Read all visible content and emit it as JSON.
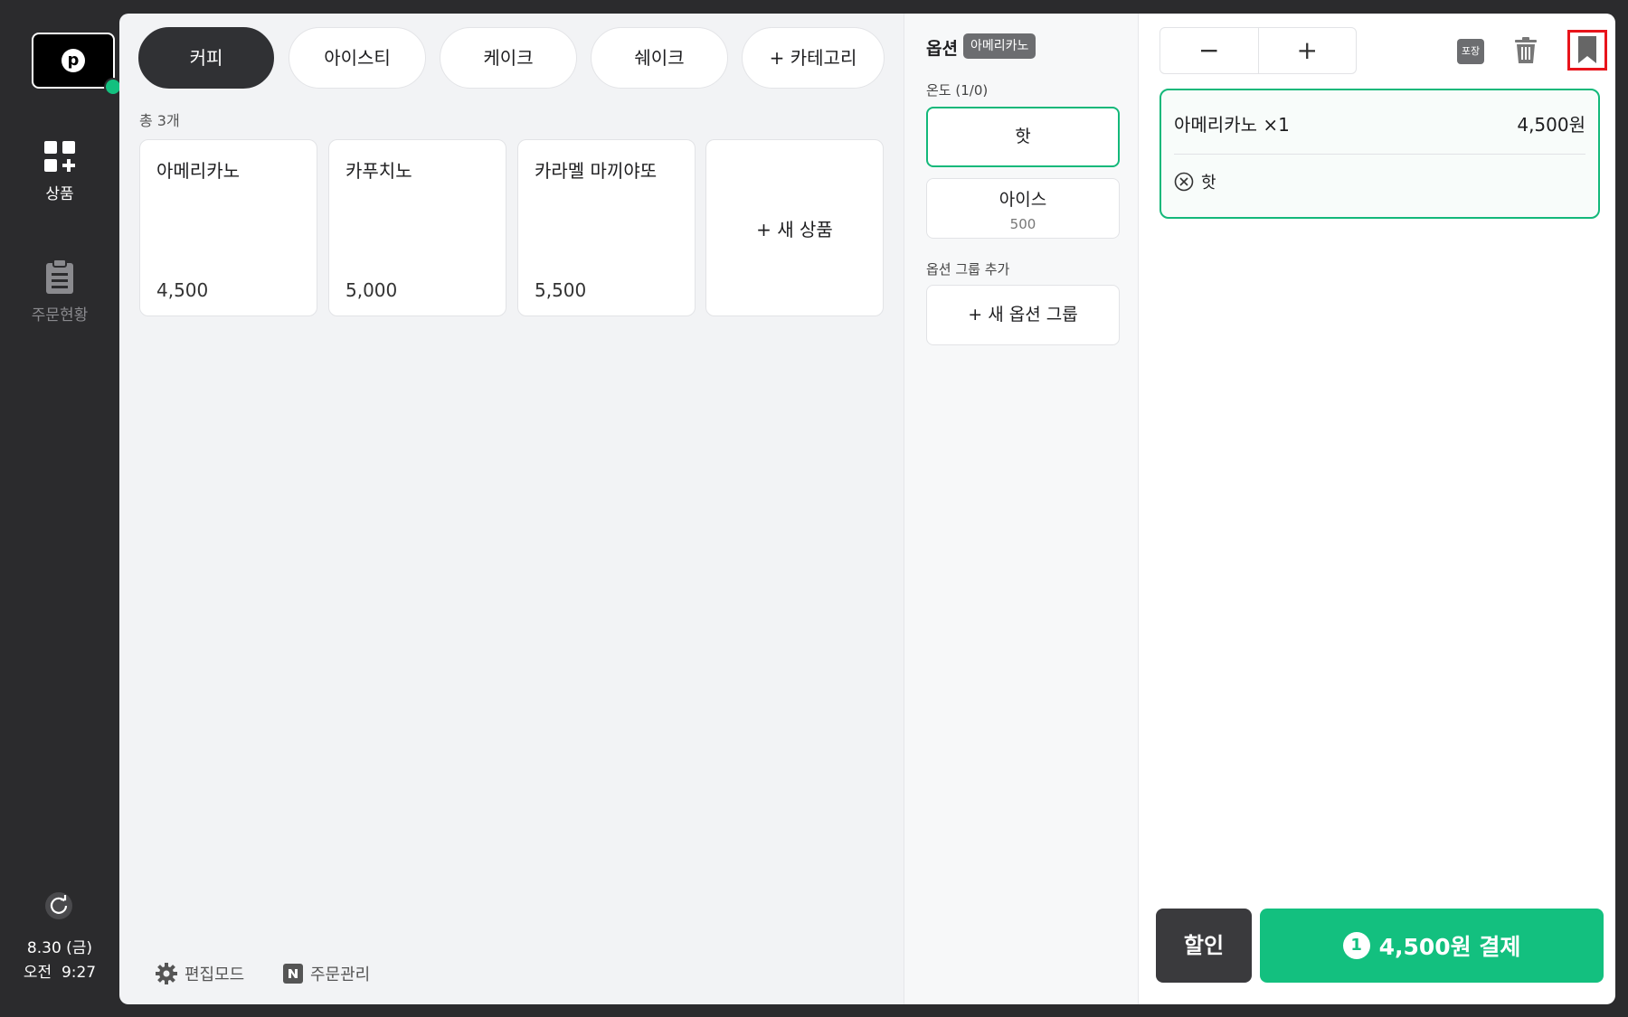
{
  "sidebar": {
    "logo_letter": "p",
    "items": [
      {
        "label": "상품",
        "icon": "grid-plus-icon"
      },
      {
        "label": "주문현황",
        "icon": "clipboard-icon"
      }
    ],
    "date": "8.30 (금)",
    "time": "오전  9:27"
  },
  "categories": {
    "tabs": [
      {
        "label": "커피",
        "active": true
      },
      {
        "label": "아이스티",
        "active": false
      },
      {
        "label": "케이크",
        "active": false
      },
      {
        "label": "쉐이크",
        "active": false
      },
      {
        "label": "+ 카테고리",
        "active": false
      }
    ]
  },
  "products": {
    "count_label": "총 3개",
    "items": [
      {
        "name": "아메리카노",
        "price": "4,500"
      },
      {
        "name": "카푸치노",
        "price": "5,000"
      },
      {
        "name": "카라멜 마끼야또",
        "price": "5,500"
      }
    ],
    "new_label": "+ 새 상품"
  },
  "footer": {
    "edit_mode": "편집모드",
    "order_mgmt": "주문관리"
  },
  "options": {
    "title": "옵션",
    "product_badge": "아메리카노",
    "group_label": "온도 (1/0)",
    "choices": [
      {
        "label": "핫",
        "extra": "",
        "selected": true
      },
      {
        "label": "아이스",
        "extra": "500",
        "selected": false
      }
    ],
    "add_group_label": "옵션 그룹 추가",
    "add_group_button": "+ 새 옵션 그룹"
  },
  "cart": {
    "minus": "−",
    "plus": "+",
    "pack_label": "포장",
    "item_name": "아메리카노 ×1",
    "item_price": "4,500원",
    "item_option": "핫",
    "discount_label": "할인",
    "pay_count": "1",
    "pay_label": "4,500원 결제"
  },
  "colors": {
    "accent": "#13c07f",
    "highlight": "#e8141b",
    "dark": "#2b2b2d"
  }
}
